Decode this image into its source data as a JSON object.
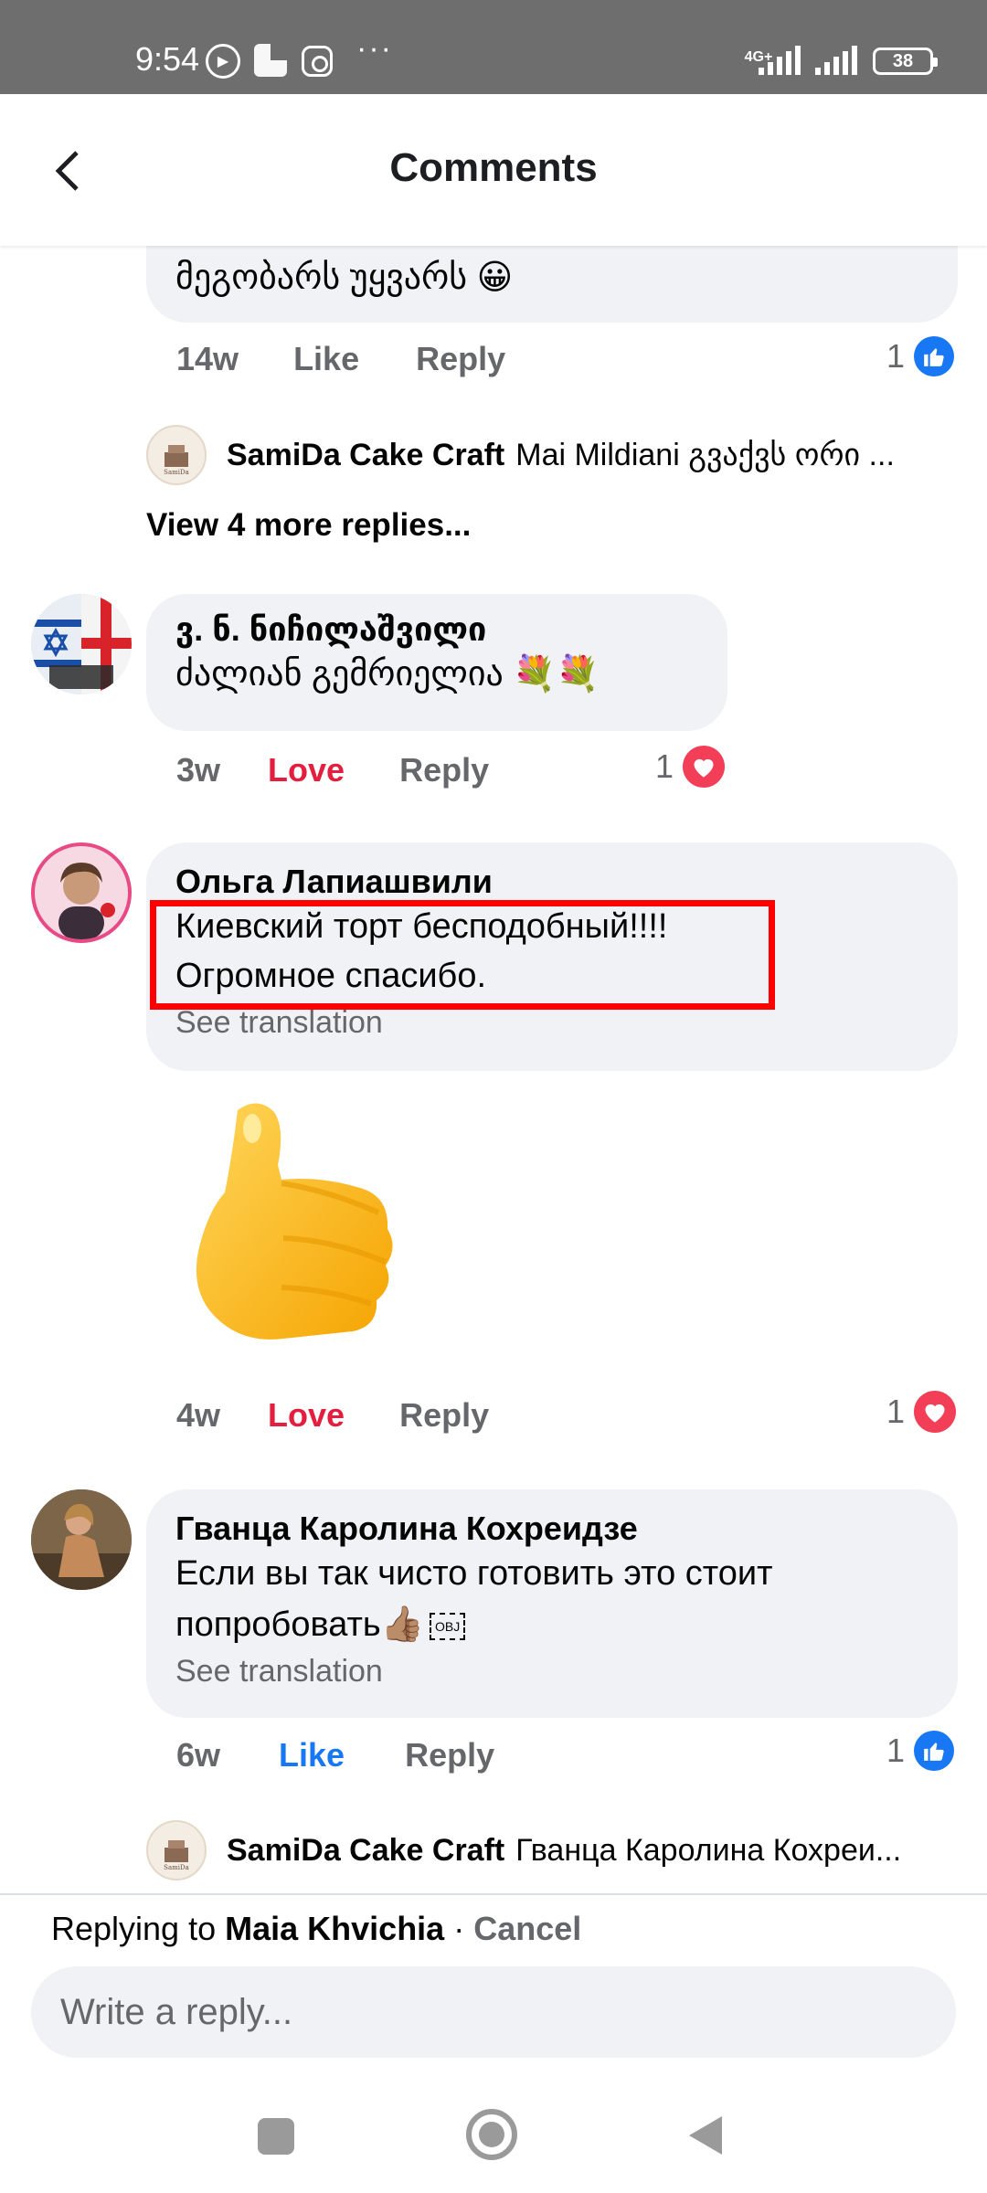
{
  "status_bar": {
    "time": "9:54",
    "network": "4G+",
    "battery": "38"
  },
  "header": {
    "title": "Comments"
  },
  "comment_top": {
    "text": "მეგობარს უყვარს 😀",
    "time": "14w",
    "like": "Like",
    "reply": "Reply",
    "reaction_count": "1"
  },
  "reply_preview_1": {
    "name": "SamiDa Cake Craft",
    "text": "Mai Mildiani გვაქვს ორი ..."
  },
  "view_more": "View 4 more replies...",
  "comment_2": {
    "name": "ვ. ნ. ნიჩილაშვილი",
    "text": "ძალიან გემრიელია 💐💐",
    "time": "3w",
    "reaction_label": "Love",
    "reply": "Reply",
    "reaction_count": "1"
  },
  "comment_3": {
    "name": "Ольга Лапиашвили",
    "text_line1": "Киевский торт бесподобный!!!!",
    "text_line2": "Огромное спасибо.",
    "see_translation": "See translation",
    "time": "4w",
    "reaction_label": "Love",
    "reply": "Reply",
    "reaction_count": "1"
  },
  "comment_4": {
    "name": "Гванца Каролина Кохреидзе",
    "text_line1": "Если вы так чисто готовить это стоит",
    "text_line2": "попробовать👍🏽",
    "obj_marker": "OBJ",
    "see_translation": "See translation",
    "time": "6w",
    "reaction_label": "Like",
    "reply": "Reply",
    "reaction_count": "1"
  },
  "reply_preview_2": {
    "name": "SamiDa Cake Craft",
    "text": "Гванца Каролина Кохреи..."
  },
  "reply_bar": {
    "prefix": "Replying to",
    "name": "Maia Khvichia",
    "separator": "·",
    "cancel": "Cancel",
    "placeholder": "Write a reply..."
  },
  "colors": {
    "like_blue": "#1877f2",
    "love_red": "#e41e3f",
    "highlight_red": "#ff0000"
  }
}
